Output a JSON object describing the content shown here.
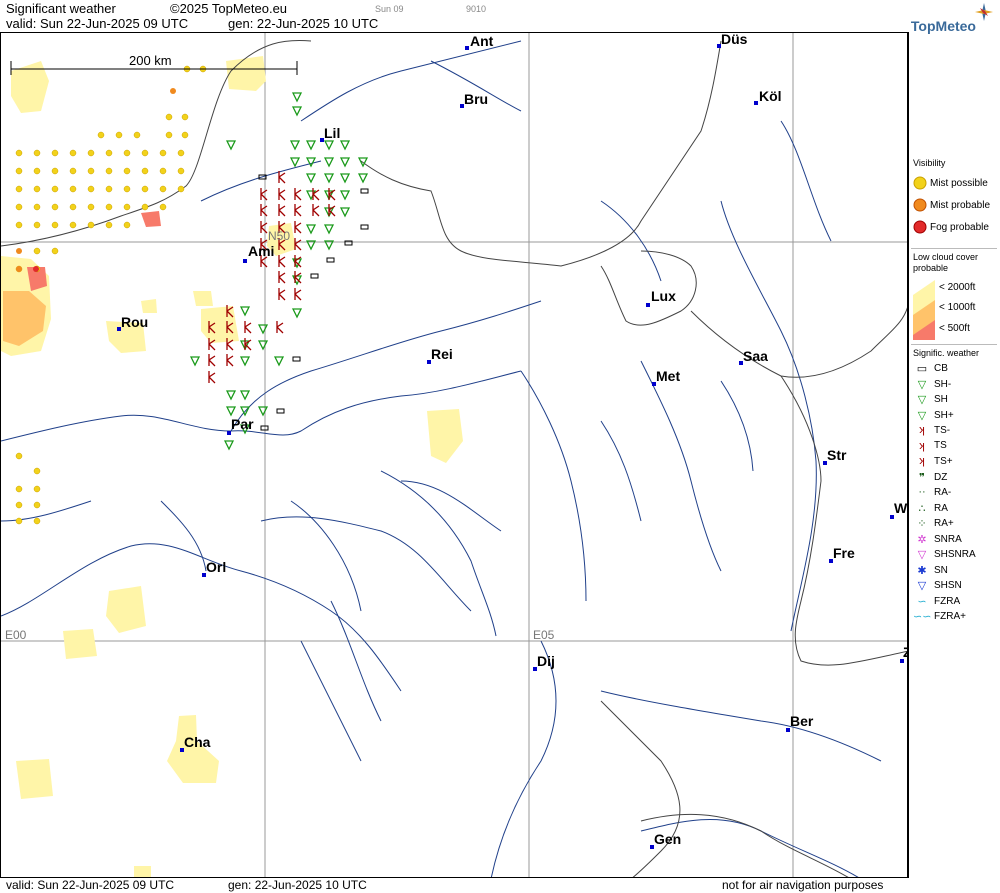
{
  "header": {
    "title": "Significant weather",
    "copyright": "©2025 TopMeteo.eu",
    "time_tab_1": "Sun 09",
    "time_tab_2": "9010",
    "valid": "valid:  Sun  22-Jun-2025  09 UTC",
    "generated": "gen: 22-Jun-2025 10 UTC"
  },
  "logo": {
    "text": "TopMeteo"
  },
  "scale": {
    "label": "200 km"
  },
  "grid_labels": {
    "n50": "N50",
    "e00": "E00",
    "e05": "E05"
  },
  "cities": [
    {
      "name": "Ant"
    },
    {
      "name": "Düs"
    },
    {
      "name": "Köl"
    },
    {
      "name": "Bru"
    },
    {
      "name": "Lil"
    },
    {
      "name": "Ami"
    },
    {
      "name": "Lux"
    },
    {
      "name": "Rou"
    },
    {
      "name": "Saa"
    },
    {
      "name": "Rei"
    },
    {
      "name": "Met"
    },
    {
      "name": "Par"
    },
    {
      "name": "Str"
    },
    {
      "name": "W"
    },
    {
      "name": "Fre"
    },
    {
      "name": "Orl"
    },
    {
      "name": "Dij"
    },
    {
      "name": "Z"
    },
    {
      "name": "Ber"
    },
    {
      "name": "Cha"
    },
    {
      "name": "Gen"
    }
  ],
  "legend": {
    "visibility": {
      "title": "Visibility",
      "items": [
        "Mist possible",
        "Mist probable",
        "Fog probable"
      ]
    },
    "low_cloud": {
      "title_1": "Low cloud cover",
      "title_2": "probable",
      "items": [
        "< 2000ft",
        "< 1000ft",
        "<   500ft"
      ]
    },
    "signific": {
      "title": "Signific. weather",
      "items": [
        "CB",
        "SH-",
        "SH",
        "SH+",
        "TS-",
        "TS",
        "TS+",
        "DZ",
        "RA-",
        "RA",
        "RA+",
        "SNRA",
        "SHSNRA",
        "SN",
        "SHSN",
        "FZRA",
        "FZRA+"
      ]
    }
  },
  "colors": {
    "low_cloud_2000": "#fff5a8",
    "low_cloud_1000": "#ffc36a",
    "low_cloud_500": "#f77a6a",
    "mist_possible": "#f2d21a",
    "mist_probable": "#f08a1e",
    "fog_probable": "#e22a2a",
    "showers": "#1a9a1a",
    "thunderstorm": "#a00000",
    "city_dot": "#0000cc"
  },
  "footer": {
    "valid": "valid:  Sun  22-Jun-2025  09 UTC",
    "generated": "gen: 22-Jun-2025 10 UTC",
    "disclaimer": "not for air navigation purposes"
  }
}
